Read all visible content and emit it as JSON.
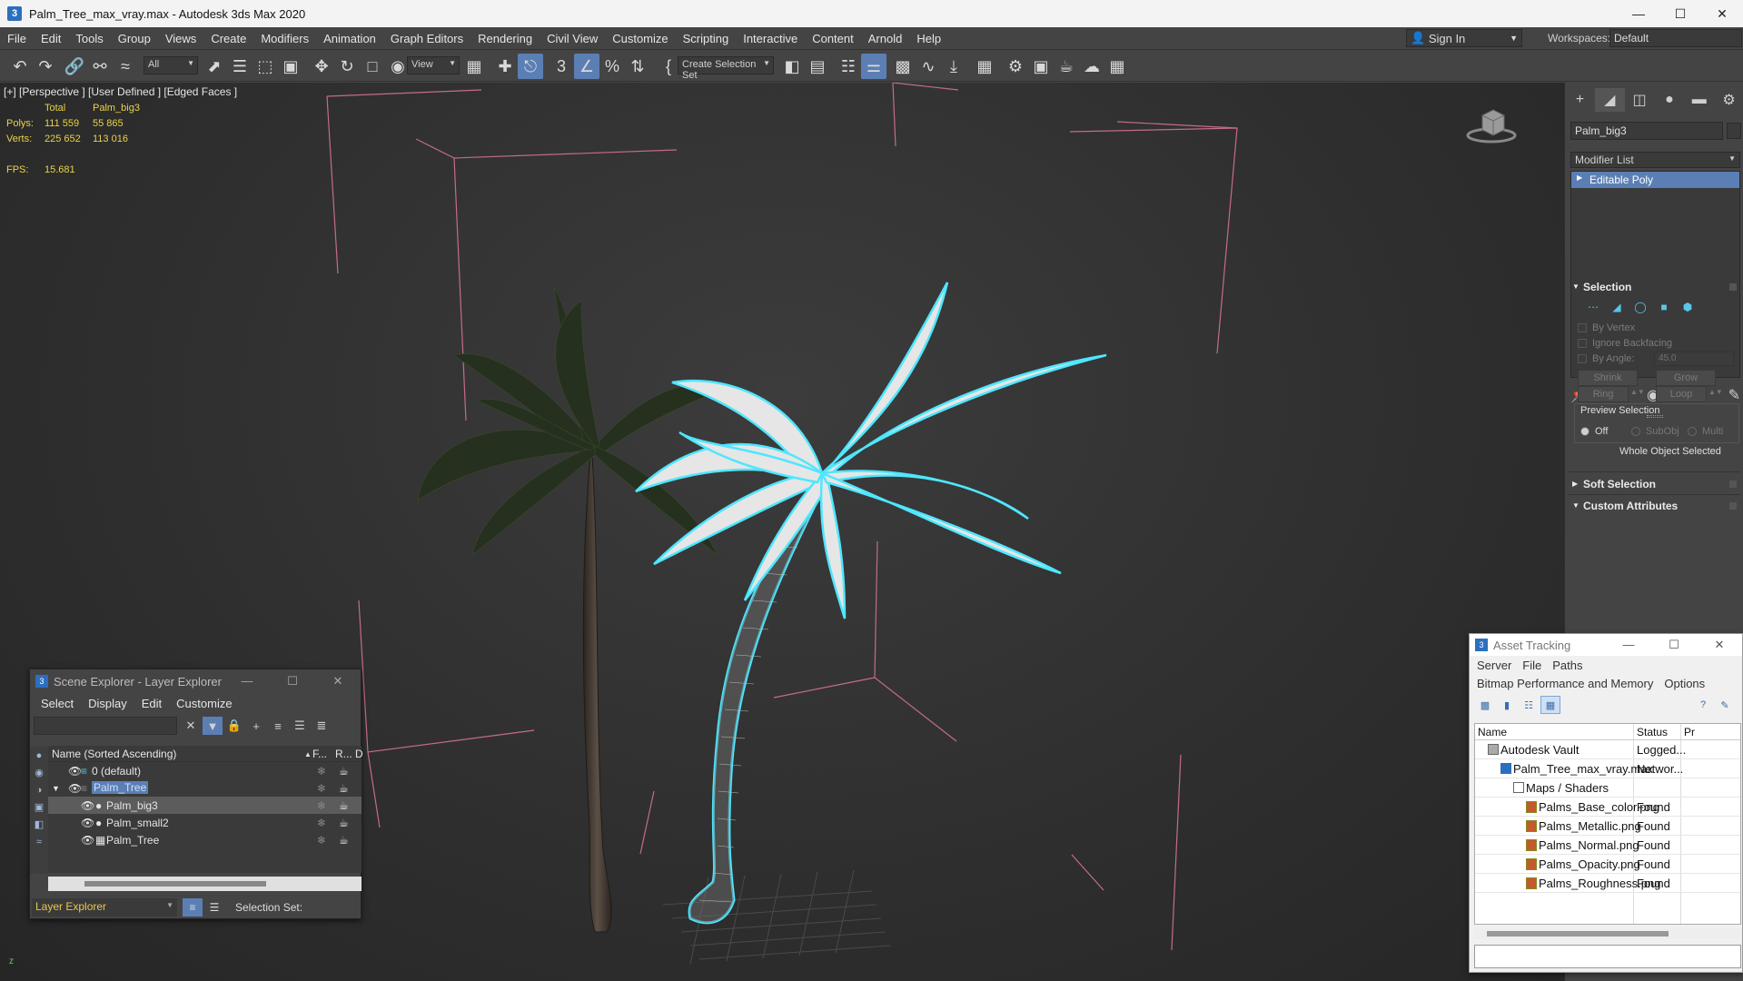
{
  "window": {
    "title": "Palm_Tree_max_vray.max - Autodesk 3ds Max 2020",
    "app_icon": "3ds-max-icon"
  },
  "menubar": [
    "File",
    "Edit",
    "Tools",
    "Group",
    "Views",
    "Create",
    "Modifiers",
    "Animation",
    "Graph Editors",
    "Rendering",
    "Civil View",
    "Customize",
    "Scripting",
    "Interactive",
    "Content",
    "Arnold",
    "Help"
  ],
  "account": {
    "sign_in": "Sign In",
    "workspaces_label": "Workspaces:",
    "workspace": "Default"
  },
  "toolbar": {
    "filter": "All",
    "ref_coord": "View",
    "selection_set": "Create Selection Set"
  },
  "viewport": {
    "label": "[+] [Perspective ] [User Defined ] [Edged Faces ]",
    "stats": {
      "col_total": "Total",
      "col_obj": "Palm_big3",
      "polys_label": "Polys:",
      "polys_total": "111 559",
      "polys_obj": "55 865",
      "verts_label": "Verts:",
      "verts_total": "225 652",
      "verts_obj": "113 016",
      "fps_label": "FPS:",
      "fps": "15.681"
    }
  },
  "command_panel": {
    "object_name": "Palm_big3",
    "modifier_list": "Modifier List",
    "stack": [
      "Editable Poly"
    ],
    "selection": {
      "title": "Selection",
      "by_vertex": "By Vertex",
      "ignore_backfacing": "Ignore Backfacing",
      "by_angle": "By Angle:",
      "angle_value": "45.0",
      "shrink": "Shrink",
      "grow": "Grow",
      "ring": "Ring",
      "loop": "Loop",
      "preview_selection": "Preview Selection",
      "off": "Off",
      "subobj": "SubObj",
      "multi": "Multi",
      "status": "Whole Object Selected"
    },
    "soft_selection": "Soft Selection",
    "custom_attributes": "Custom Attributes"
  },
  "scene_explorer": {
    "title": "Scene Explorer - Layer Explorer",
    "menu": [
      "Select",
      "Display",
      "Edit",
      "Customize"
    ],
    "header": {
      "name": "Name (Sorted Ascending)",
      "f": "F...",
      "r": "R...",
      "d": "D"
    },
    "rows": [
      {
        "name": "0 (default)"
      },
      {
        "name": "Palm_Tree"
      },
      {
        "name": "Palm_big3"
      },
      {
        "name": "Palm_small2"
      },
      {
        "name": "Palm_Tree"
      }
    ],
    "layer_dropdown": "Layer Explorer",
    "selection_set_label": "Selection Set:"
  },
  "asset_tracking": {
    "title": "Asset Tracking",
    "menu1": [
      "Server",
      "File",
      "Paths"
    ],
    "menu2": [
      "Bitmap Performance and Memory",
      "Options"
    ],
    "columns": {
      "name": "Name",
      "status": "Status",
      "p": "Pr"
    },
    "rows": [
      {
        "name": "Autodesk Vault",
        "status": "Logged..."
      },
      {
        "name": "Palm_Tree_max_vray.max",
        "status": "Networ..."
      },
      {
        "name": "Maps / Shaders",
        "status": ""
      },
      {
        "name": "Palms_Base_color.png",
        "status": "Found"
      },
      {
        "name": "Palms_Metallic.png",
        "status": "Found"
      },
      {
        "name": "Palms_Normal.png",
        "status": "Found"
      },
      {
        "name": "Palms_Opacity.png",
        "status": "Found"
      },
      {
        "name": "Palms_Roughness.png",
        "status": "Found"
      }
    ]
  },
  "colors": {
    "accent": "#5b7fb5",
    "selection_wire": "#4fe6ff",
    "stats": "#e8d24a"
  }
}
